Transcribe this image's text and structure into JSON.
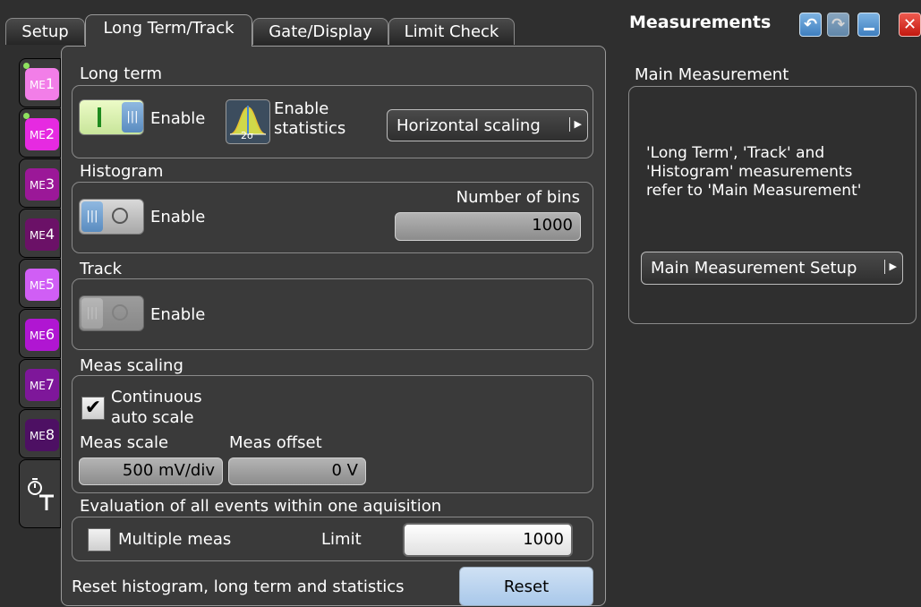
{
  "tabs": [
    "Setup",
    "Long Term/Track",
    "Gate/Display",
    "Limit Check"
  ],
  "dialog_title": "Measurements",
  "side_tabs": [
    {
      "label": "ME",
      "num": "1",
      "color": "#f27ee8",
      "led": true
    },
    {
      "label": "ME",
      "num": "2",
      "color": "#e62ae1",
      "led": true
    },
    {
      "label": "ME",
      "num": "3",
      "color": "#9b1898",
      "led": false
    },
    {
      "label": "ME",
      "num": "4",
      "color": "#6b1167",
      "led": false
    },
    {
      "label": "ME",
      "num": "5",
      "color": "#d05ef5",
      "led": false
    },
    {
      "label": "ME",
      "num": "6",
      "color": "#b016d2",
      "led": false
    },
    {
      "label": "ME",
      "num": "7",
      "color": "#7e179a",
      "led": false
    },
    {
      "label": "ME",
      "num": "8",
      "color": "#4d1063",
      "led": false
    }
  ],
  "long_term": {
    "heading": "Long term",
    "enable_label": "Enable",
    "enable_toggle_state": "on",
    "stats_label_line1": "Enable",
    "stats_label_line2": "statistics",
    "stats_icon_text": "2σ",
    "horizontal_scaling": "Horizontal scaling"
  },
  "histogram": {
    "heading": "Histogram",
    "enable_label": "Enable",
    "enable_toggle_state": "off",
    "bins_label": "Number of bins",
    "bins_value": "1000"
  },
  "track": {
    "heading": "Track",
    "enable_label": "Enable",
    "enable_toggle_state": "disabled"
  },
  "meas_scaling": {
    "heading": "Meas scaling",
    "auto_line1": "Continuous",
    "auto_line2": "auto scale",
    "auto_checked": true,
    "scale_label": "Meas scale",
    "scale_value": "500 mV/div",
    "offset_label": "Meas offset",
    "offset_value": "0 V"
  },
  "evaluation": {
    "heading": "Evaluation of all events within one aquisition",
    "multiple_label": "Multiple meas",
    "multiple_checked": false,
    "limit_label": "Limit",
    "limit_value": "1000"
  },
  "reset": {
    "text": "Reset histogram, long term and statistics",
    "button": "Reset"
  },
  "main_measurement": {
    "heading": "Main Measurement",
    "info_line1": "'Long Term', 'Track' and",
    "info_line2": "'Histogram' measurements",
    "info_line3": "refer to 'Main Measurement'",
    "setup_button": "Main Measurement Setup"
  },
  "colors": {
    "panel": "#3a3a3a",
    "window_btn_blue": "#4d8fc9",
    "close_red": "#d9261c",
    "reset_button": "#b8d2ee"
  }
}
